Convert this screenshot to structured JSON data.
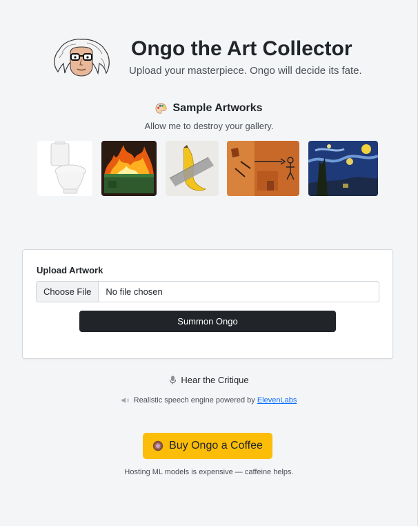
{
  "header": {
    "title": "Ongo the Art Collector",
    "subtitle": "Upload your masterpiece. Ongo will decide its fate."
  },
  "samples": {
    "title": "Sample Artworks",
    "subtitle": "Allow me to destroy your gallery.",
    "items": [
      {
        "name": "toilet"
      },
      {
        "name": "dumpster-fire"
      },
      {
        "name": "taped-banana"
      },
      {
        "name": "stick-figure-painting"
      },
      {
        "name": "starry-night"
      }
    ]
  },
  "upload": {
    "label": "Upload Artwork",
    "choose_label": "Choose File",
    "status": "No file chosen",
    "submit_label": "Summon Ongo"
  },
  "critique": {
    "hear_label": "Hear the Critique",
    "powered_text": "Realistic speech engine powered by",
    "powered_link": "ElevenLabs"
  },
  "coffee": {
    "button_label": "Buy Ongo a Coffee",
    "note": "Hosting ML models is expensive — caffeine helps."
  },
  "colors": {
    "background": "#f4f5f7",
    "primary_button": "#212529",
    "coffee_button": "#fbbd08",
    "link": "#0d6efd"
  }
}
